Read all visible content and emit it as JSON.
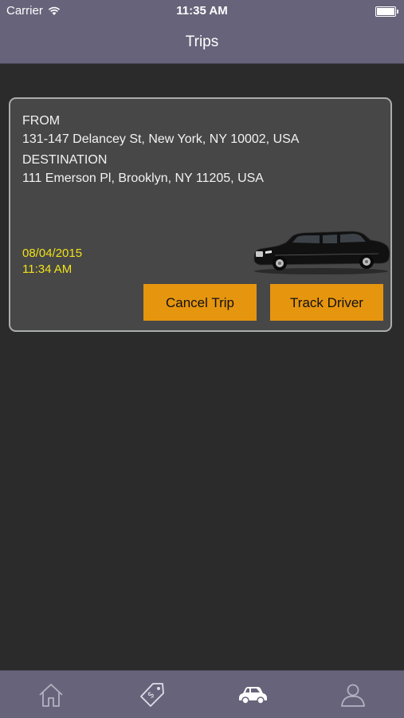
{
  "status_bar": {
    "carrier": "Carrier",
    "time": "11:35 AM"
  },
  "nav": {
    "title": "Trips"
  },
  "trip": {
    "from_label": "FROM",
    "from_address": "131-147 Delancey St, New York, NY 10002, USA",
    "destination_label": "DESTINATION",
    "destination_address": "111 Emerson Pl, Brooklyn, NY 11205, USA",
    "date": "08/04/2015",
    "time": "11:34 AM",
    "vehicle_image": "black-limousine",
    "cancel_label": "Cancel Trip",
    "track_label": "Track Driver"
  },
  "tabbar": {
    "items": [
      {
        "icon": "home-icon",
        "active": false
      },
      {
        "icon": "price-tag-icon",
        "active": false
      },
      {
        "icon": "car-icon",
        "active": true
      },
      {
        "icon": "profile-icon",
        "active": false
      }
    ]
  },
  "colors": {
    "bar": "#67637a",
    "background": "#2b2b2b",
    "card": "#474747",
    "card_border": "#a9adab",
    "button": "#e6950f",
    "date_text": "#f0e21a"
  }
}
